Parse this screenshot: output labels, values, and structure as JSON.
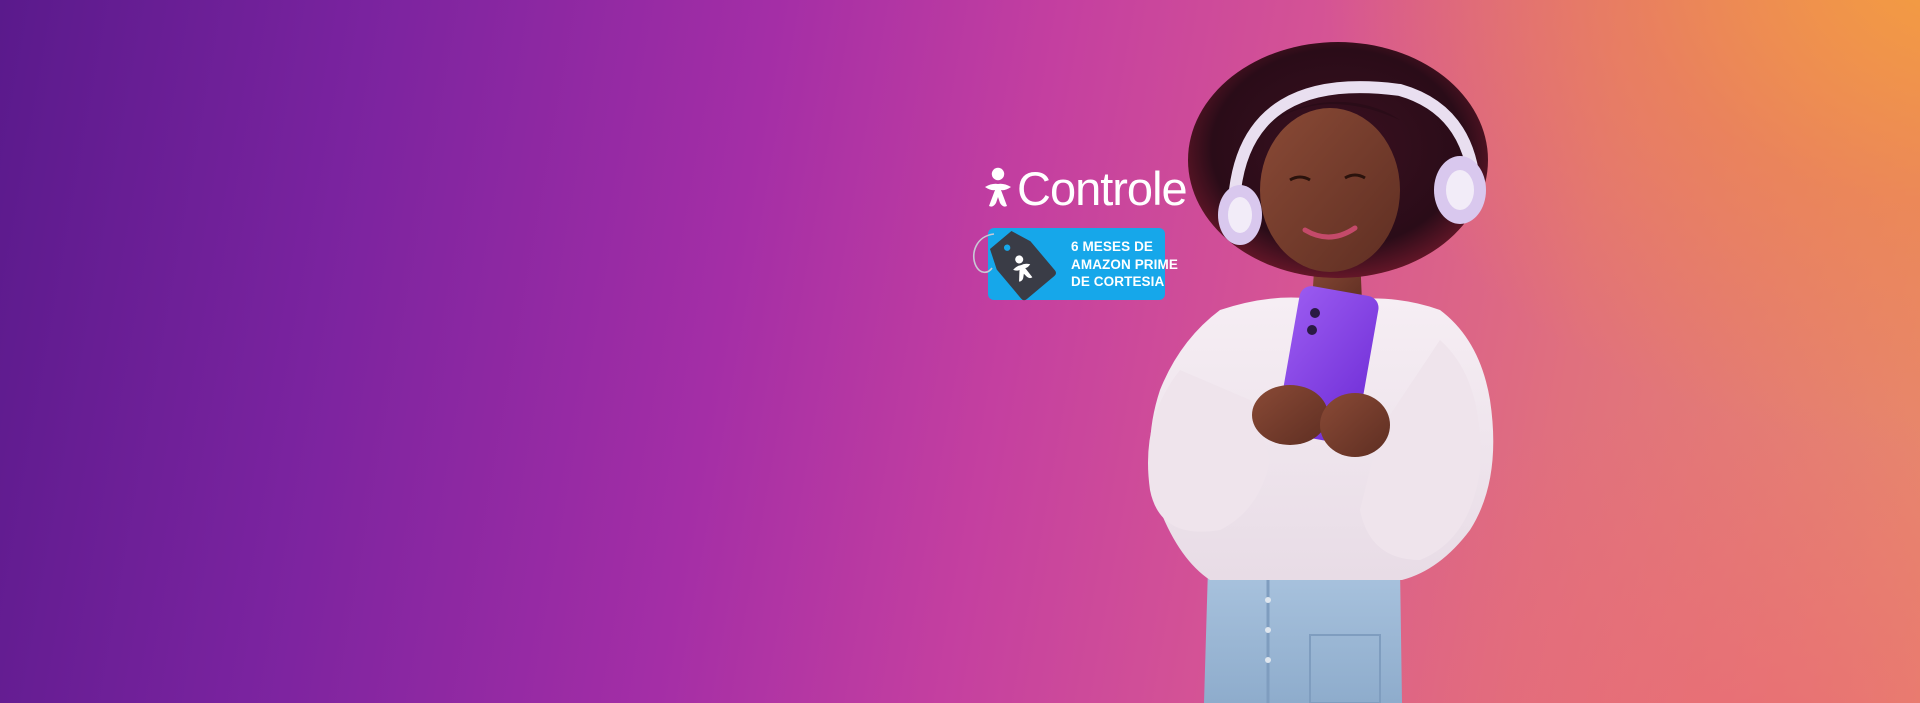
{
  "brand": {
    "name": "Controle",
    "logo_icon": "vivo-figure-icon"
  },
  "promo": {
    "line1": "6 MESES DE",
    "line2": "AMAZON PRIME",
    "line3": "DE CORTESIA",
    "tag_icon": "price-tag-icon",
    "badge_color": "#16a7ea"
  },
  "hero": {
    "image": "woman-with-headphones-and-phone",
    "gradient_colors": [
      "#5a1a8c",
      "#c43fa0",
      "#e8896a",
      "#f5a03c"
    ]
  }
}
